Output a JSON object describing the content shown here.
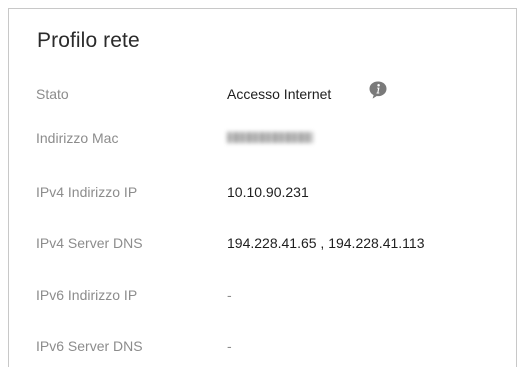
{
  "panel": {
    "title": "Profilo rete"
  },
  "rows": [
    {
      "label": "Stato",
      "value": "Accesso Internet",
      "icon": "info-icon"
    },
    {
      "label": "Indirizzo Mac",
      "value_redacted": true
    },
    {
      "label": "IPv4 Indirizzo IP",
      "value": "10.10.90.231"
    },
    {
      "label": "IPv4 Server DNS",
      "value": "194.228.41.65 , 194.228.41.113"
    },
    {
      "label": "IPv6 Indirizzo IP",
      "value": "-"
    },
    {
      "label": "IPv6 Server DNS",
      "value": "-"
    }
  ],
  "colors": {
    "label": "#8c8c8c",
    "value": "#1e1e1e",
    "info_icon": "#7a7a7a",
    "border": "#c8c8c8"
  }
}
